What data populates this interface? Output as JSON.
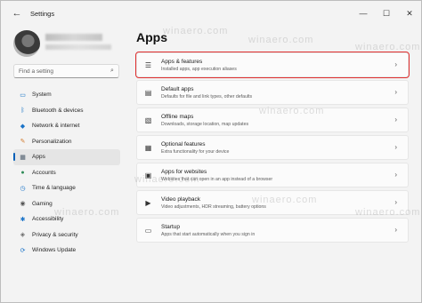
{
  "window": {
    "title": "Settings",
    "back_glyph": "←",
    "controls": {
      "minimize": "—",
      "maximize": "☐",
      "close": "✕"
    }
  },
  "sidebar": {
    "search_placeholder": "Find a setting",
    "items": [
      {
        "label": "System",
        "icon": "monitor-icon",
        "color": "#0067c0"
      },
      {
        "label": "Bluetooth & devices",
        "icon": "bluetooth-icon",
        "color": "#0067c0"
      },
      {
        "label": "Network & internet",
        "icon": "wifi-icon",
        "color": "#1a73c8"
      },
      {
        "label": "Personalization",
        "icon": "paintbrush-icon",
        "color": "#d27a2c"
      },
      {
        "label": "Apps",
        "icon": "apps-icon",
        "color": "#4a5a6a",
        "active": true
      },
      {
        "label": "Accounts",
        "icon": "person-icon",
        "color": "#2e8b57"
      },
      {
        "label": "Time & language",
        "icon": "globe-clock-icon",
        "color": "#1a73c8"
      },
      {
        "label": "Gaming",
        "icon": "gamepad-icon",
        "color": "#555555"
      },
      {
        "label": "Accessibility",
        "icon": "accessibility-icon",
        "color": "#1a73c8"
      },
      {
        "label": "Privacy & security",
        "icon": "shield-icon",
        "color": "#666666"
      },
      {
        "label": "Windows Update",
        "icon": "update-icon",
        "color": "#1a73c8"
      }
    ]
  },
  "main": {
    "title": "Apps",
    "rows": [
      {
        "title": "Apps & features",
        "desc": "Installed apps, app execution aliases",
        "icon": "list-icon",
        "highlight": true
      },
      {
        "title": "Default apps",
        "desc": "Defaults for file and link types, other defaults",
        "icon": "default-apps-icon"
      },
      {
        "title": "Offline maps",
        "desc": "Downloads, storage location, map updates",
        "icon": "map-icon"
      },
      {
        "title": "Optional features",
        "desc": "Extra functionality for your device",
        "icon": "optional-features-icon"
      },
      {
        "title": "Apps for websites",
        "desc": "Websites that can open in an app instead of a browser",
        "icon": "web-apps-icon"
      },
      {
        "title": "Video playback",
        "desc": "Video adjustments, HDR streaming, battery options",
        "icon": "video-icon"
      },
      {
        "title": "Startup",
        "desc": "Apps that start automatically when you sign in",
        "icon": "startup-icon"
      }
    ],
    "chevron": "›"
  },
  "colors": {
    "accent": "#005fb8",
    "highlight_border": "#e03030"
  },
  "watermark": "winaero.com"
}
